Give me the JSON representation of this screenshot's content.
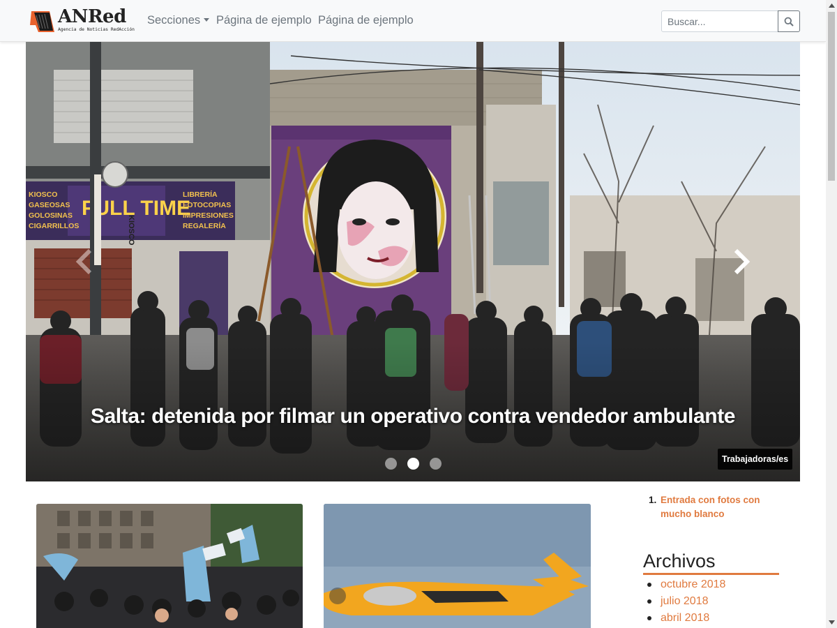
{
  "brand": {
    "name": "ANRed",
    "tagline": "Agencia de Noticias RedAcción"
  },
  "nav": {
    "items": [
      {
        "label": "Secciones",
        "dropdown": true
      },
      {
        "label": "Página de ejemplo"
      },
      {
        "label": "Página de ejemplo"
      }
    ]
  },
  "search": {
    "placeholder": "Buscar...",
    "value": "",
    "icon": "search-icon"
  },
  "carousel": {
    "caption": "Salta: detenida por filmar un operativo contra vendedor ambulante",
    "category": "Trabajadoras/es",
    "slide_count": 3,
    "active_slide": 2,
    "prev_icon": "chevron-left-icon",
    "next_icon": "chevron-right-icon",
    "signs": {
      "kiosco": "KIOSCO",
      "shop_left": "KIOSCO\nGASEOSAS\nGOLOSINAS\nCIGARRILLOS",
      "fulltime": "FULL TIME",
      "shop_right": "LIBRERÍA\nFOTOCOPIAS\nIMPRESIONES\nREGALERÍA"
    }
  },
  "sidebar": {
    "recent": [
      {
        "index": "1.",
        "title": "Entrada con fotos con mucho blanco"
      }
    ],
    "archives_title": "Archivos",
    "archives": [
      "octubre 2018",
      "julio 2018",
      "abril 2018"
    ]
  },
  "colors": {
    "accent": "#e07a3f",
    "navbar_bg": "#f8f9fa",
    "nav_text": "#6c757d"
  }
}
